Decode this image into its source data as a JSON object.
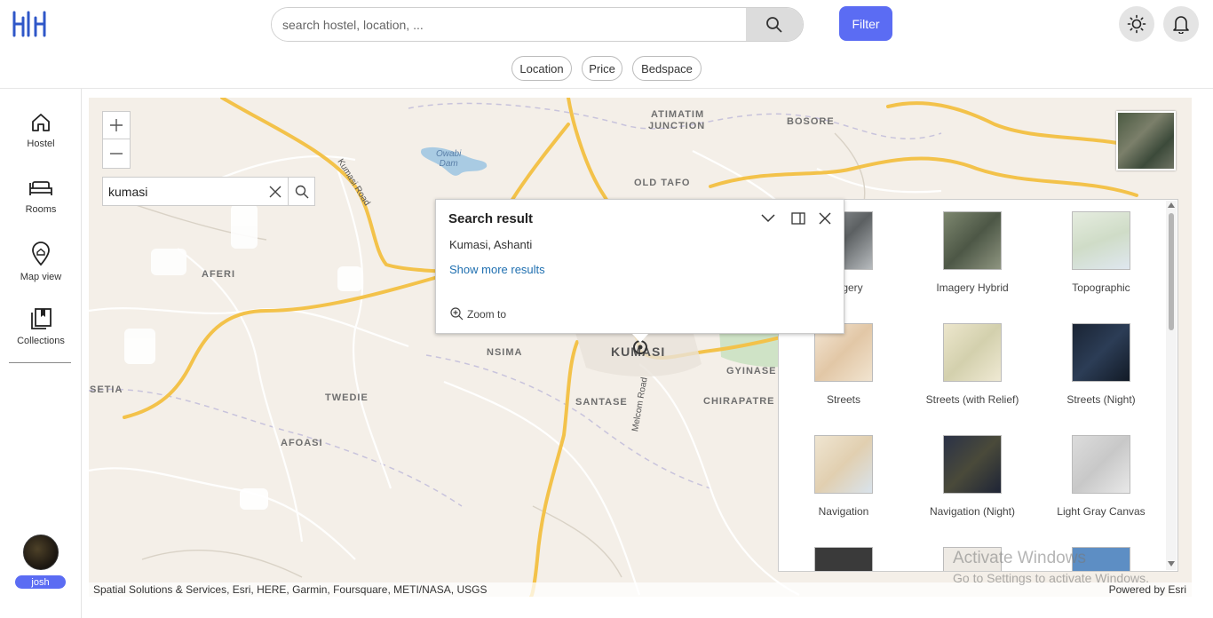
{
  "header": {
    "search_placeholder": "search hostel, location, ...",
    "filter_label": "Filter",
    "chips": [
      "Location",
      "Price",
      "Bedspace"
    ]
  },
  "sidebar": {
    "items": [
      {
        "label": "Hostel",
        "icon": "home-icon"
      },
      {
        "label": "Rooms",
        "icon": "bed-icon"
      },
      {
        "label": "Map view",
        "icon": "map-pin-icon"
      },
      {
        "label": "Collections",
        "icon": "collections-icon"
      }
    ],
    "user": "josh"
  },
  "map": {
    "search_value": "kumasi",
    "places": {
      "aferi": "AFERI",
      "atimatim": "ATIMATIM",
      "junction": "JUNCTION",
      "bosore": "BOSORE",
      "old_tafo": "OLD TAFO",
      "nsima": "NSIMA",
      "kumasi": "KUMASI",
      "gyinase": "GYINASE",
      "twedie": "TWEDIE",
      "santase": "SANTASE",
      "chirapatre": "CHIRAPATRE",
      "afoasi": "AFOASI",
      "setia": "SETIA"
    },
    "roads": {
      "kumasi_road": "Kumasi Road",
      "melcom_road": "Melcom Road"
    },
    "water": {
      "owabi": "Owabi",
      "dam": "Dam"
    },
    "attribution_left": "Spatial Solutions & Services, Esri, HERE, Garmin, Foursquare, METI/NASA, USGS",
    "attribution_right": "Powered by Esri"
  },
  "popup": {
    "title": "Search result",
    "result": "Kumasi, Ashanti",
    "more_link": "Show more results",
    "zoom_label": "Zoom to"
  },
  "basemaps": [
    {
      "label": "Imagery",
      "color": "#8a8e90"
    },
    {
      "label": "Imagery Hybrid",
      "color": "#6b7660"
    },
    {
      "label": "Topographic",
      "color": "#dfe6d8"
    },
    {
      "label": "Streets",
      "color": "#efe4d4"
    },
    {
      "label": "Streets (with Relief)",
      "color": "#e6e2c8"
    },
    {
      "label": "Streets (Night)",
      "color": "#1f2a3a"
    },
    {
      "label": "Navigation",
      "color": "#ece2cf"
    },
    {
      "label": "Navigation (Night)",
      "color": "#2a3146"
    },
    {
      "label": "Light Gray Canvas",
      "color": "#d8d8d8"
    }
  ],
  "watermark": {
    "line1": "Activate Windows",
    "line2": "Go to Settings to activate Windows."
  },
  "colors": {
    "accent": "#5b6cf3",
    "map_background": "#f4efe8",
    "major_road": "#f7c744",
    "link": "#1f6fb0"
  }
}
